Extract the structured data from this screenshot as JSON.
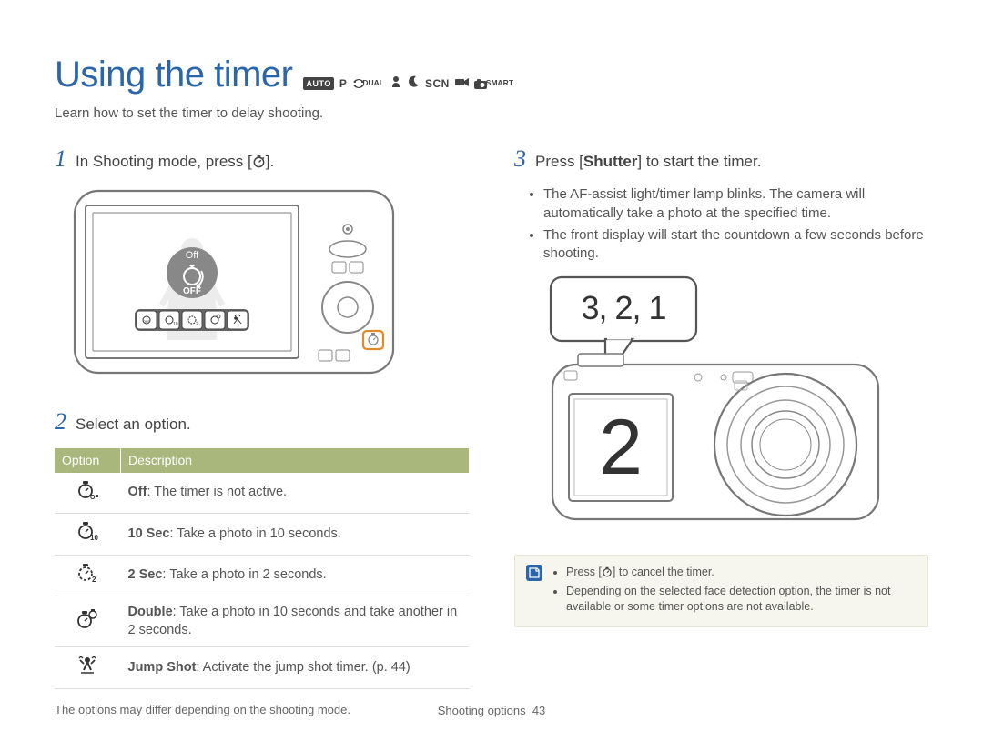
{
  "title": "Using the timer",
  "mode_labels": {
    "auto": "AUTO",
    "p": "P",
    "dual": "DUAL",
    "scn": "SCN",
    "smart": "SMART"
  },
  "subtitle": "Learn how to set the timer to delay shooting.",
  "step1": {
    "num": "1",
    "prefix": "In Shooting mode, press [",
    "suffix": "]."
  },
  "step2": {
    "num": "2",
    "text": "Select an option."
  },
  "step3": {
    "num": "3",
    "prefix": "Press [",
    "bold": "Shutter",
    "suffix": "] to start the timer."
  },
  "bullets3": [
    "The AF-assist light/timer lamp blinks. The camera will automatically take a photo at the specified time.",
    "The front display will start the countdown a few seconds before shooting."
  ],
  "camera_back": {
    "off_label_top": "Off",
    "off_label_btn": "OFF"
  },
  "camera_front": {
    "speech": "3, 2, 1",
    "display_num": "2"
  },
  "table": {
    "headers": [
      "Option",
      "Description"
    ],
    "rows": [
      {
        "icon": "OFF",
        "bold": "Off",
        "rest": ": The timer is not active."
      },
      {
        "icon": "10",
        "bold": "10 Sec",
        "rest": ": Take a photo in 10 seconds."
      },
      {
        "icon": "2",
        "bold": "2 Sec",
        "rest": ": Take a photo in 2 seconds."
      },
      {
        "icon": "double",
        "bold": "Double",
        "rest": ": Take a photo in 10 seconds and take another in 2 seconds."
      },
      {
        "icon": "jump",
        "bold": "Jump Shot",
        "rest": ": Activate the jump shot timer. (p. 44)"
      }
    ],
    "footnote": "The options may differ depending on the shooting mode."
  },
  "notebox": {
    "note1_prefix": "Press [",
    "note1_suffix": "] to cancel the timer.",
    "note2": "Depending on the selected face detection option, the timer is not available or some timer options are not available."
  },
  "footer": {
    "section": "Shooting options",
    "page": "43"
  }
}
